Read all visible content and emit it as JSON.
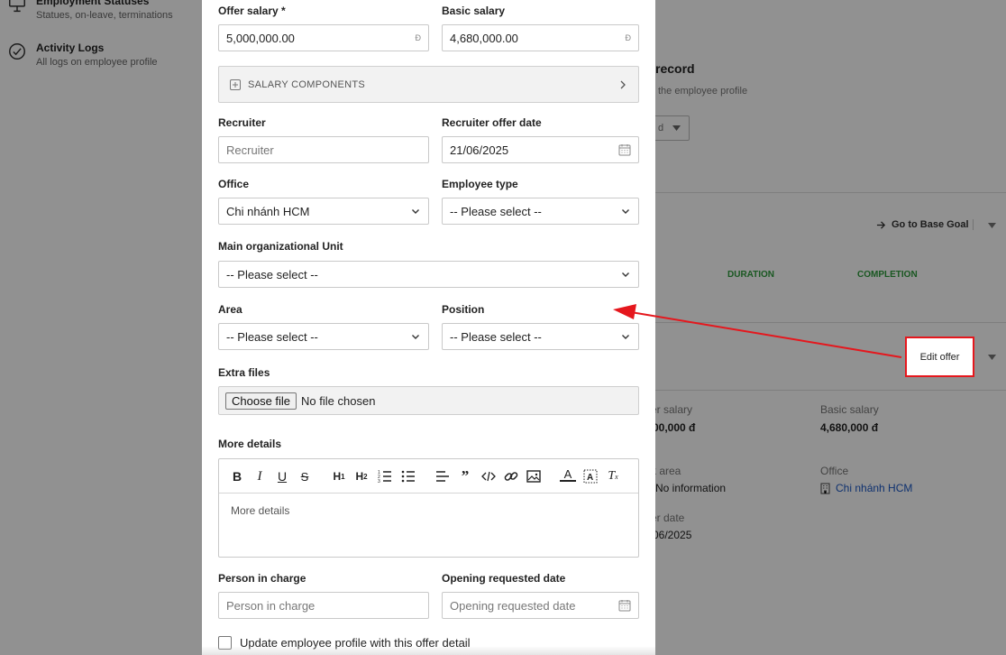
{
  "sidebar": {
    "items": [
      {
        "title": "Employment Statuses",
        "subtitle": "Statues, on-leave, terminations"
      },
      {
        "title": "Activity Logs",
        "subtitle": "All logs on employee profile"
      }
    ]
  },
  "background": {
    "record_title": "record",
    "record_subtitle": "the employee profile",
    "select_partial": "d",
    "go_to_base_goal": "Go to Base Goal",
    "col_duration": "DURATION",
    "col_completion": "COMPLETION",
    "edit_offer": "Edit offer",
    "offer_salary_label": "er salary",
    "offer_salary_value": "00,000 đ",
    "basic_salary_label": "Basic salary",
    "basic_salary_value": "4,680,000 đ",
    "work_area_label": "k area",
    "work_area_value": "No information",
    "office_label": "Office",
    "office_value": "Chi nhánh HCM",
    "offer_date_label": "er date",
    "offer_date_value": "06/2025"
  },
  "modal": {
    "offer_salary": {
      "label": "Offer salary *",
      "value": "5,000,000.00",
      "suffix": "Đ"
    },
    "basic_salary": {
      "label": "Basic salary",
      "value": "4,680,000.00",
      "suffix": "Đ"
    },
    "salary_components": "SALARY COMPONENTS",
    "recruiter": {
      "label": "Recruiter",
      "placeholder": "Recruiter"
    },
    "recruiter_offer_date": {
      "label": "Recruiter offer date",
      "value": "21/06/2025"
    },
    "office": {
      "label": "Office",
      "value": "Chi nhánh HCM"
    },
    "employee_type": {
      "label": "Employee type",
      "value": "-- Please select --"
    },
    "main_org_unit": {
      "label": "Main organizational Unit",
      "value": "-- Please select --"
    },
    "area": {
      "label": "Area",
      "value": "-- Please select --"
    },
    "position": {
      "label": "Position",
      "value": "-- Please select --"
    },
    "extra_files": {
      "label": "Extra files",
      "button": "Choose file",
      "status": "No file chosen"
    },
    "more_details": {
      "label": "More details",
      "placeholder": "More details"
    },
    "person_in_charge": {
      "label": "Person in charge",
      "placeholder": "Person in charge"
    },
    "opening_requested_date": {
      "label": "Opening requested date",
      "placeholder": "Opening requested date"
    },
    "update_profile": "Update employee profile with this offer detail"
  },
  "colors": {
    "accent_red": "#e5171d",
    "green": "#2e9b3c",
    "link": "#1a56c4"
  }
}
